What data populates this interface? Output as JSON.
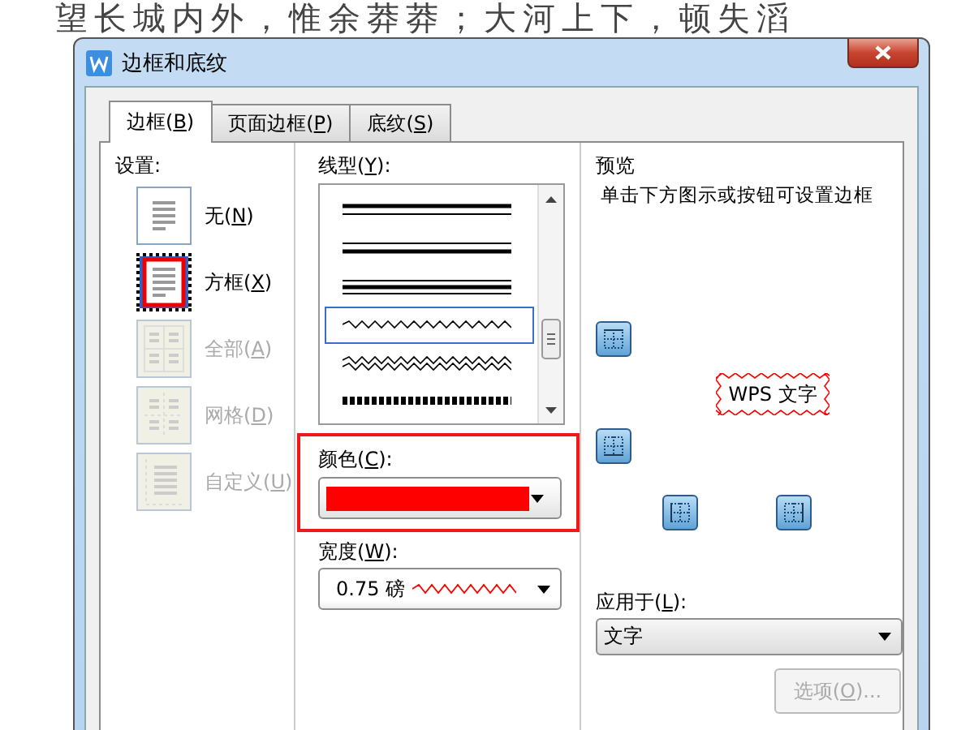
{
  "document": {
    "text": "望长城内外，惟余莽莽；大河上下，顿失滔"
  },
  "window": {
    "title": "边框和底纹"
  },
  "tabs": [
    {
      "label": "边框(B)",
      "selected": true
    },
    {
      "label": "页面边框(P)",
      "selected": false
    },
    {
      "label": "底纹(S)",
      "selected": false
    }
  ],
  "settings": {
    "label": "设置:",
    "items": [
      {
        "label": "无(N)",
        "kind": "none",
        "selected": false,
        "disabled": false
      },
      {
        "label": "方框(X)",
        "kind": "box",
        "selected": true,
        "disabled": false
      },
      {
        "label": "全部(A)",
        "kind": "all",
        "selected": false,
        "disabled": true
      },
      {
        "label": "网格(D)",
        "kind": "grid",
        "selected": false,
        "disabled": true
      },
      {
        "label": "自定义(U)",
        "kind": "custom",
        "selected": false,
        "disabled": true
      }
    ]
  },
  "line_style": {
    "label": "线型(Y):",
    "options": [
      {
        "kind": "thick-thin",
        "selected": false
      },
      {
        "kind": "thin-thick",
        "selected": false
      },
      {
        "kind": "thin-thick-thin",
        "selected": false
      },
      {
        "kind": "wave",
        "selected": true
      },
      {
        "kind": "double-wave",
        "selected": false
      },
      {
        "kind": "hatched",
        "selected": false
      }
    ]
  },
  "color": {
    "label": "颜色(C):",
    "color": "#ff0000",
    "highlighted": true
  },
  "width": {
    "label": "宽度(W):",
    "value": "0.75 磅"
  },
  "preview": {
    "label": "预览",
    "hint": "单击下方图示或按钮可设置边框",
    "sample": "WPS 文字",
    "buttons": [
      {
        "kind": "top"
      },
      {
        "kind": "bottom"
      },
      {
        "kind": "left"
      },
      {
        "kind": "right"
      }
    ]
  },
  "apply_to": {
    "label": "应用于(L):",
    "value": "文字"
  },
  "options_button": {
    "label": "选项(O)...",
    "disabled": true
  }
}
